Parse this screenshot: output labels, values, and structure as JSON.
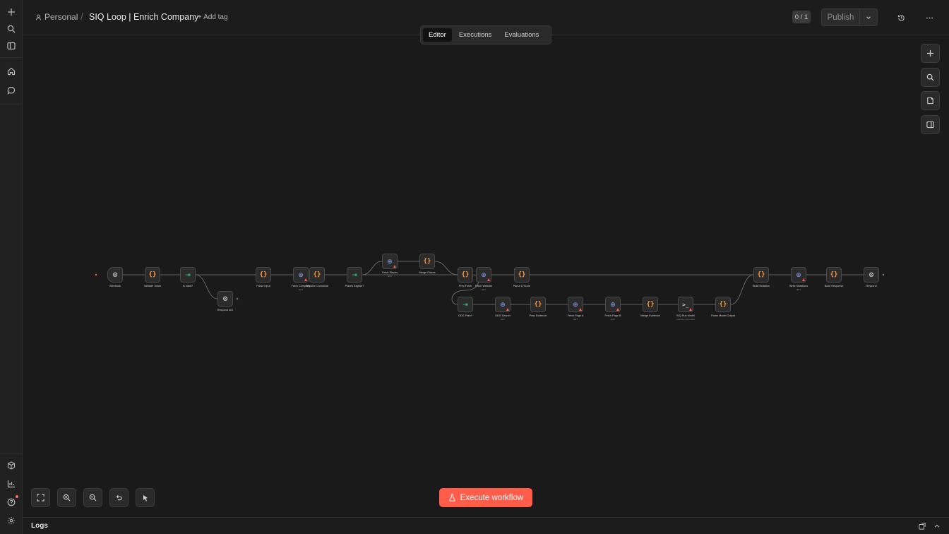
{
  "header": {
    "owner": "Personal",
    "separator": "/",
    "title": "SIQ Loop | Enrich Company",
    "add_tag": "+ Add tag",
    "counter": "0 / 1",
    "publish": "Publish"
  },
  "tabs": [
    {
      "label": "Editor",
      "active": true
    },
    {
      "label": "Executions",
      "active": false
    },
    {
      "label": "Evaluations",
      "active": false
    }
  ],
  "toolbar": {
    "execute": "Execute workflow"
  },
  "logs": {
    "title": "Logs"
  },
  "colors": {
    "accent": "#ff5c4a",
    "code_icon": "#ff9b3d",
    "if_icon": "#35d07f",
    "http_icon": "#8ca5ff"
  },
  "nodes": [
    {
      "id": "webhook",
      "label": "Webhook",
      "sub": "",
      "icon": "webhook-icon"
    },
    {
      "id": "validate",
      "label": "Validate Token",
      "sub": "",
      "icon": "code-icon"
    },
    {
      "id": "isvalid",
      "label": "Is Valid?",
      "sub": "",
      "icon": "if-icon"
    },
    {
      "id": "respond401",
      "label": "Respond 401",
      "sub": "",
      "icon": "webhook-icon"
    },
    {
      "id": "parseinput",
      "label": "Parse Input",
      "sub": "",
      "icon": "code-icon"
    },
    {
      "id": "fetchcompany",
      "label": "Fetch Company",
      "sub": "GET",
      "icon": "globe-icon"
    },
    {
      "id": "resolvecanon",
      "label": "Resolve Canonical",
      "sub": "",
      "icon": "code-icon"
    },
    {
      "id": "placeselig",
      "label": "Places Eligible?",
      "sub": "",
      "icon": "if-icon"
    },
    {
      "id": "fetchplaces",
      "label": "Fetch Places",
      "sub": "GET",
      "icon": "globe-icon"
    },
    {
      "id": "mergeplaces",
      "label": "Merge Places",
      "sub": "",
      "icon": "code-icon"
    },
    {
      "id": "prepfetch",
      "label": "Prep Fetch",
      "sub": "",
      "icon": "code-icon"
    },
    {
      "id": "fetchwebsite",
      "label": "Fetch Website",
      "sub": "GET",
      "icon": "globe-icon"
    },
    {
      "id": "parsescore",
      "label": "Parse & Score",
      "sub": "",
      "icon": "code-icon"
    },
    {
      "id": "ddgpath",
      "label": "DDG Path?",
      "sub": "",
      "icon": "if-icon"
    },
    {
      "id": "ddgsearch",
      "label": "DDG Search",
      "sub": "GET",
      "icon": "globe-icon"
    },
    {
      "id": "prepevidence",
      "label": "Prep Evidence",
      "sub": "",
      "icon": "code-icon"
    },
    {
      "id": "fetchpagea",
      "label": "Fetch Page A",
      "sub": "GET",
      "icon": "globe-icon"
    },
    {
      "id": "fetchpageb",
      "label": "Fetch Page B",
      "sub": "GET",
      "icon": "globe-icon"
    },
    {
      "id": "mergeevidence",
      "label": "Merge Evidence",
      "sub": "",
      "icon": "code-icon"
    },
    {
      "id": "siqrun",
      "label": "SIQ Run Model",
      "sub": "execute: command",
      "icon": "terminal-icon"
    },
    {
      "id": "parsemodel",
      "label": "Parse Model Output",
      "sub": "",
      "icon": "code-icon"
    },
    {
      "id": "buildmutation",
      "label": "Build Mutation",
      "sub": "",
      "icon": "code-icon"
    },
    {
      "id": "writemut",
      "label": "Write Mutations",
      "sub": "GET",
      "icon": "globe-icon"
    },
    {
      "id": "buildresp",
      "label": "Build Response",
      "sub": "",
      "icon": "code-icon"
    },
    {
      "id": "respond",
      "label": "Respond",
      "sub": "",
      "icon": "webhook-icon"
    }
  ]
}
